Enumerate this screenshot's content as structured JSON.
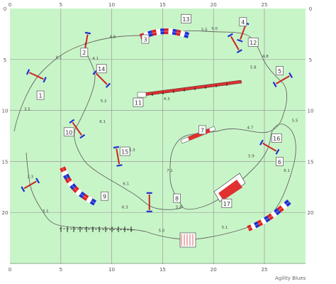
{
  "colors": {
    "field": "#c8f5c8",
    "grid": "#9a9a9a",
    "path": "#666666",
    "tunnel_red": "#e02020",
    "tunnel_blue": "#2030d0",
    "bar_red": "#e03030",
    "pole_red": "#cc2222",
    "label_border": "#666666"
  },
  "grid": {
    "x_ticks": [
      "0",
      "5",
      "10",
      "15",
      "20",
      "25"
    ],
    "y_ticks": [
      "0",
      "5",
      "10",
      "15",
      "20"
    ],
    "max_x": 29,
    "max_y": 23.5
  },
  "obstacles": [
    {
      "num": "1",
      "type": "jump",
      "x": 2.6,
      "y": 6.6,
      "angle": 25,
      "lx": 3.0,
      "ly": 8.5
    },
    {
      "num": "2",
      "type": "jump",
      "x": 7.5,
      "y": 3.3,
      "angle": -80,
      "lx": 7.3,
      "ly": 4.3
    },
    {
      "num": "3",
      "type": "curved-tunnel",
      "lx": 13.3,
      "ly": 3.0
    },
    {
      "num": "4",
      "type": "jump",
      "x": 22.9,
      "y": 2.3,
      "angle": -70,
      "lx": 22.9,
      "ly": 1.3
    },
    {
      "num": "5",
      "type": "jump",
      "x": 26.8,
      "y": 7.0,
      "angle": -30,
      "lx": 26.5,
      "ly": 6.1
    },
    {
      "num": "6",
      "type": "curved-tunnel",
      "lx": 26.5,
      "ly": 15.0
    },
    {
      "num": "7",
      "type": "seesaw",
      "lx": 18.9,
      "ly": 11.9
    },
    {
      "num": "8",
      "type": "jump",
      "x": 13.7,
      "y": 19.0,
      "angle": 90,
      "lx": 16.4,
      "ly": 18.6
    },
    {
      "num": "9",
      "type": "curved-tunnel",
      "lx": 9.3,
      "ly": 18.4
    },
    {
      "num": "10",
      "type": "jump",
      "x": 6.6,
      "y": 11.8,
      "angle": 55,
      "lx": 5.8,
      "ly": 12.1
    },
    {
      "num": "11",
      "type": "dogwalk",
      "lx": 12.6,
      "ly": 9.2
    },
    {
      "num": "12",
      "type": "jump",
      "x": 22.1,
      "y": 3.4,
      "angle": 60,
      "lx": 23.9,
      "ly": 3.3
    },
    {
      "num": "13",
      "type": "tunnel-label",
      "lx": 17.3,
      "ly": 1.0
    },
    {
      "num": "14",
      "type": "jump",
      "x": 9.0,
      "y": 6.9,
      "angle": 45,
      "lx": 9.0,
      "ly": 5.9
    },
    {
      "num": "15",
      "type": "jump",
      "x": 10.6,
      "y": 14.5,
      "angle": 80,
      "lx": 11.3,
      "ly": 14.0
    },
    {
      "num": "16",
      "type": "jump",
      "x": 25.5,
      "y": 13.6,
      "angle": 30,
      "lx": 26.2,
      "ly": 12.7
    },
    {
      "num": "17",
      "type": "a-frame",
      "lx": 21.3,
      "ly": 19.1
    }
  ],
  "distances": [
    {
      "t": "4.1",
      "x": 4.8,
      "y": 4.9
    },
    {
      "t": "4.6",
      "x": 10.1,
      "y": 2.9
    },
    {
      "t": "4.1",
      "x": 8.4,
      "y": 5.0
    },
    {
      "t": "5.2",
      "x": 9.2,
      "y": 9.2
    },
    {
      "t": "6.1",
      "x": 9.1,
      "y": 11.2
    },
    {
      "t": "5.3",
      "x": 12.0,
      "y": 14.0
    },
    {
      "t": "6.1",
      "x": 11.4,
      "y": 17.3
    },
    {
      "t": "6.3",
      "x": 11.3,
      "y": 19.6
    },
    {
      "t": "4.3",
      "x": 15.4,
      "y": 9.0
    },
    {
      "t": "5.5",
      "x": 19.1,
      "y": 2.2
    },
    {
      "t": "5.0",
      "x": 20.1,
      "y": 2.1
    },
    {
      "t": "4.8",
      "x": 25.1,
      "y": 4.8
    },
    {
      "t": "5.8",
      "x": 23.9,
      "y": 5.9
    },
    {
      "t": "5.5",
      "x": 28.0,
      "y": 11.1
    },
    {
      "t": "4.7",
      "x": 23.6,
      "y": 11.8
    },
    {
      "t": "5.9",
      "x": 23.7,
      "y": 14.6
    },
    {
      "t": "6.1",
      "x": 27.2,
      "y": 16.0
    },
    {
      "t": "7.1",
      "x": 15.7,
      "y": 16.0
    },
    {
      "t": "5.8",
      "x": 16.6,
      "y": 19.6
    },
    {
      "t": "5.0",
      "x": 14.9,
      "y": 21.9
    },
    {
      "t": "5.1",
      "x": 21.1,
      "y": 21.6
    },
    {
      "t": "2.3",
      "x": 2.0,
      "y": 16.6
    },
    {
      "t": "3.5",
      "x": 1.7,
      "y": 10.0
    },
    {
      "t": "3.1",
      "x": 3.5,
      "y": 20.0
    }
  ],
  "footer": "Agility Blues"
}
